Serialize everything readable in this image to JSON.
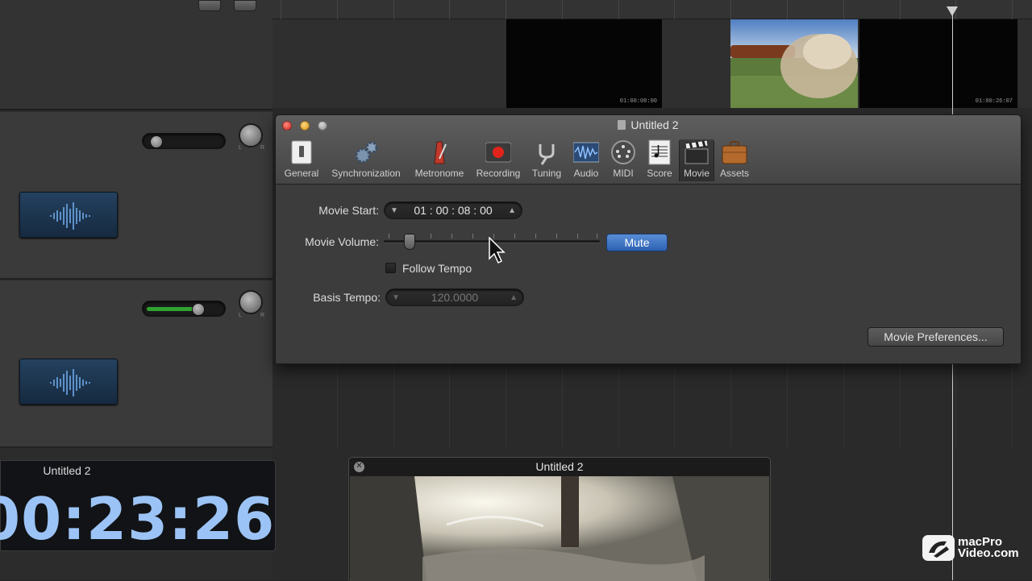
{
  "settings_window": {
    "title": "Untitled 2",
    "toolbar": [
      {
        "label": "General",
        "icon": "light-switch-icon"
      },
      {
        "label": "Synchronization",
        "icon": "gears-icon"
      },
      {
        "label": "Metronome",
        "icon": "metronome-icon"
      },
      {
        "label": "Recording",
        "icon": "record-icon"
      },
      {
        "label": "Tuning",
        "icon": "tuning-fork-icon"
      },
      {
        "label": "Audio",
        "icon": "waveform-icon"
      },
      {
        "label": "MIDI",
        "icon": "midi-port-icon"
      },
      {
        "label": "Score",
        "icon": "score-sheet-icon"
      },
      {
        "label": "Movie",
        "icon": "clapperboard-icon"
      },
      {
        "label": "Assets",
        "icon": "briefcase-icon"
      }
    ],
    "selected_tab": "Movie",
    "movie_start_label": "Movie Start:",
    "movie_start_value": "01 : 00 : 08 : 00",
    "movie_volume_label": "Movie Volume:",
    "movie_volume_level": 0.12,
    "mute_label": "Mute",
    "follow_tempo_label": "Follow Tempo",
    "follow_tempo_checked": false,
    "basis_tempo_label": "Basis Tempo:",
    "basis_tempo_value": "120.0000",
    "movie_prefs_button": "Movie Preferences..."
  },
  "movie_track": {
    "thumb_timecodes": [
      "01:00:08:00",
      "01:00:26:07"
    ]
  },
  "lcd": {
    "title": "Untitled 2",
    "time": "00:23:26"
  },
  "movie_window": {
    "title": "Untitled 2"
  },
  "pan_labels": {
    "left": "L",
    "right": "R"
  },
  "watermark": {
    "line1": "macPro",
    "line2": "Video.com"
  },
  "colors": {
    "lcd_digits": "#9cc3f5",
    "mute_button": "#3a72c6",
    "fader_green": "#2fa32f"
  }
}
